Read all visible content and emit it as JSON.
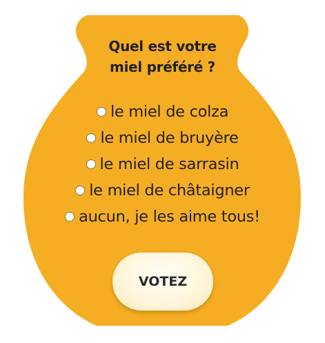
{
  "poll": {
    "question_line1": "Quel est votre",
    "question_line2": "miel préféré ?",
    "options": [
      "le miel de colza",
      "le miel de bruyère",
      "le miel de sarrasin",
      "le miel de châtaigner",
      "aucun, je les aime tous!"
    ],
    "vote_label": "VOTEZ"
  },
  "colors": {
    "pot": "#F5AD24",
    "text": "#222222",
    "button": "#FFF6DC"
  }
}
